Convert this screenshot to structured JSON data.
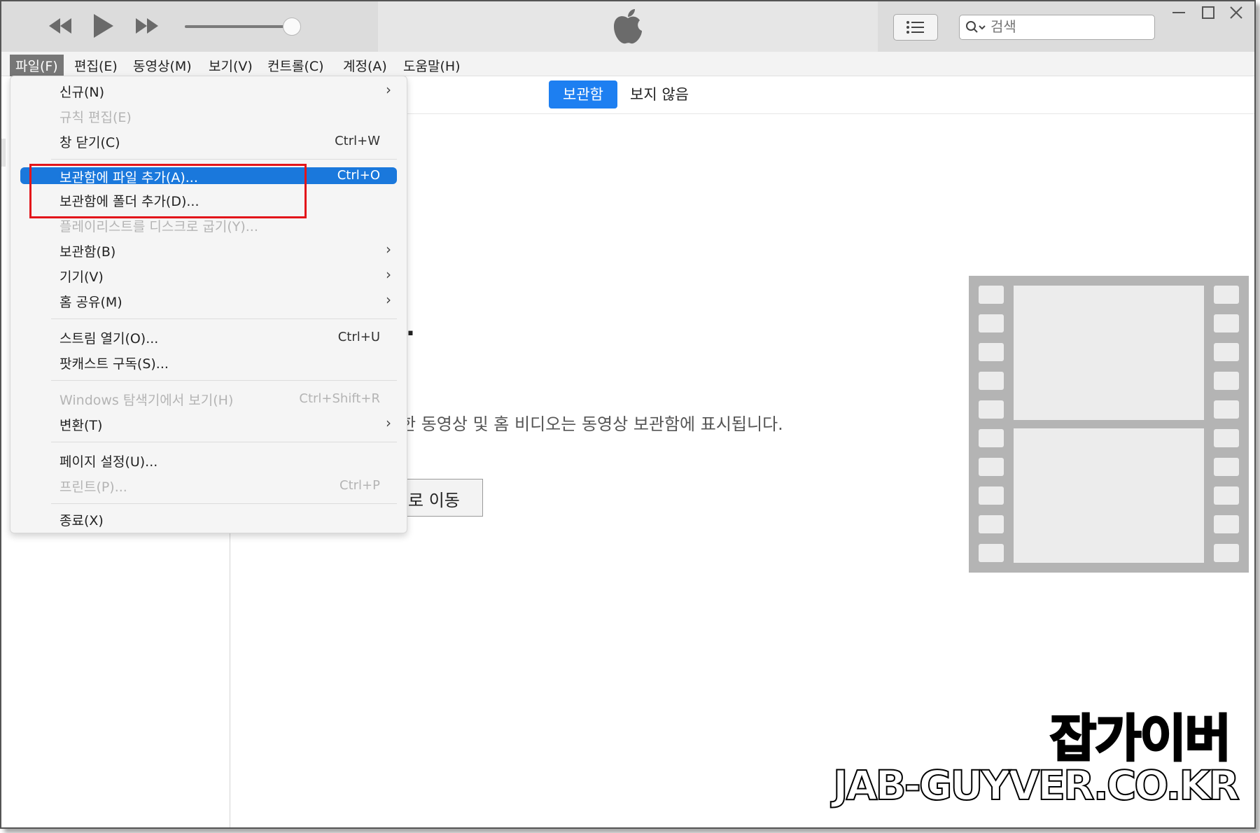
{
  "search": {
    "placeholder": "검색"
  },
  "menubar": [
    "파일(F)",
    "편집(E)",
    "동영상(M)",
    "보기(V)",
    "컨트롤(C)",
    "계정(A)",
    "도움말(H)"
  ],
  "tabs": {
    "library": "보관함",
    "unwatched": "보지 않음"
  },
  "file_menu": {
    "new": "신규(N)",
    "edit_rule": "규칙 편집(E)",
    "close_window": "창 닫기(C)",
    "close_window_sc": "Ctrl+W",
    "add_file": "보관함에 파일 추가(A)...",
    "add_file_sc": "Ctrl+O",
    "add_folder": "보관함에 폴더 추가(D)...",
    "burn_playlist": "플레이리스트를 디스크로 굽기(Y)...",
    "library": "보관함(B)",
    "devices": "기기(V)",
    "home_sharing": "홈 공유(M)",
    "open_stream": "스트림 열기(O)...",
    "open_stream_sc": "Ctrl+U",
    "subscribe_podcast": "팟캐스트 구독(S)...",
    "show_in_explorer": "Windows 탐색기에서 보기(H)",
    "show_in_explorer_sc": "Ctrl+Shift+R",
    "convert": "변환(T)",
    "page_setup": "페이지 설정(U)...",
    "print": "프린트(P)...",
    "print_sc": "Ctrl+P",
    "exit": "종료(X)"
  },
  "main": {
    "heading_fragment": ".",
    "description_fragment": "한 동영상 및 홈 비디오는 동영상 보관함에 표시됩니다.",
    "button_fragment": "로 이동"
  },
  "watermark": {
    "korean": "잡가이버",
    "url": "JAB-GUYVER.CO.KR"
  },
  "colors": {
    "accent": "#1d7ff1",
    "highlight": "#1a78dc",
    "annotation": "#e3151a"
  }
}
